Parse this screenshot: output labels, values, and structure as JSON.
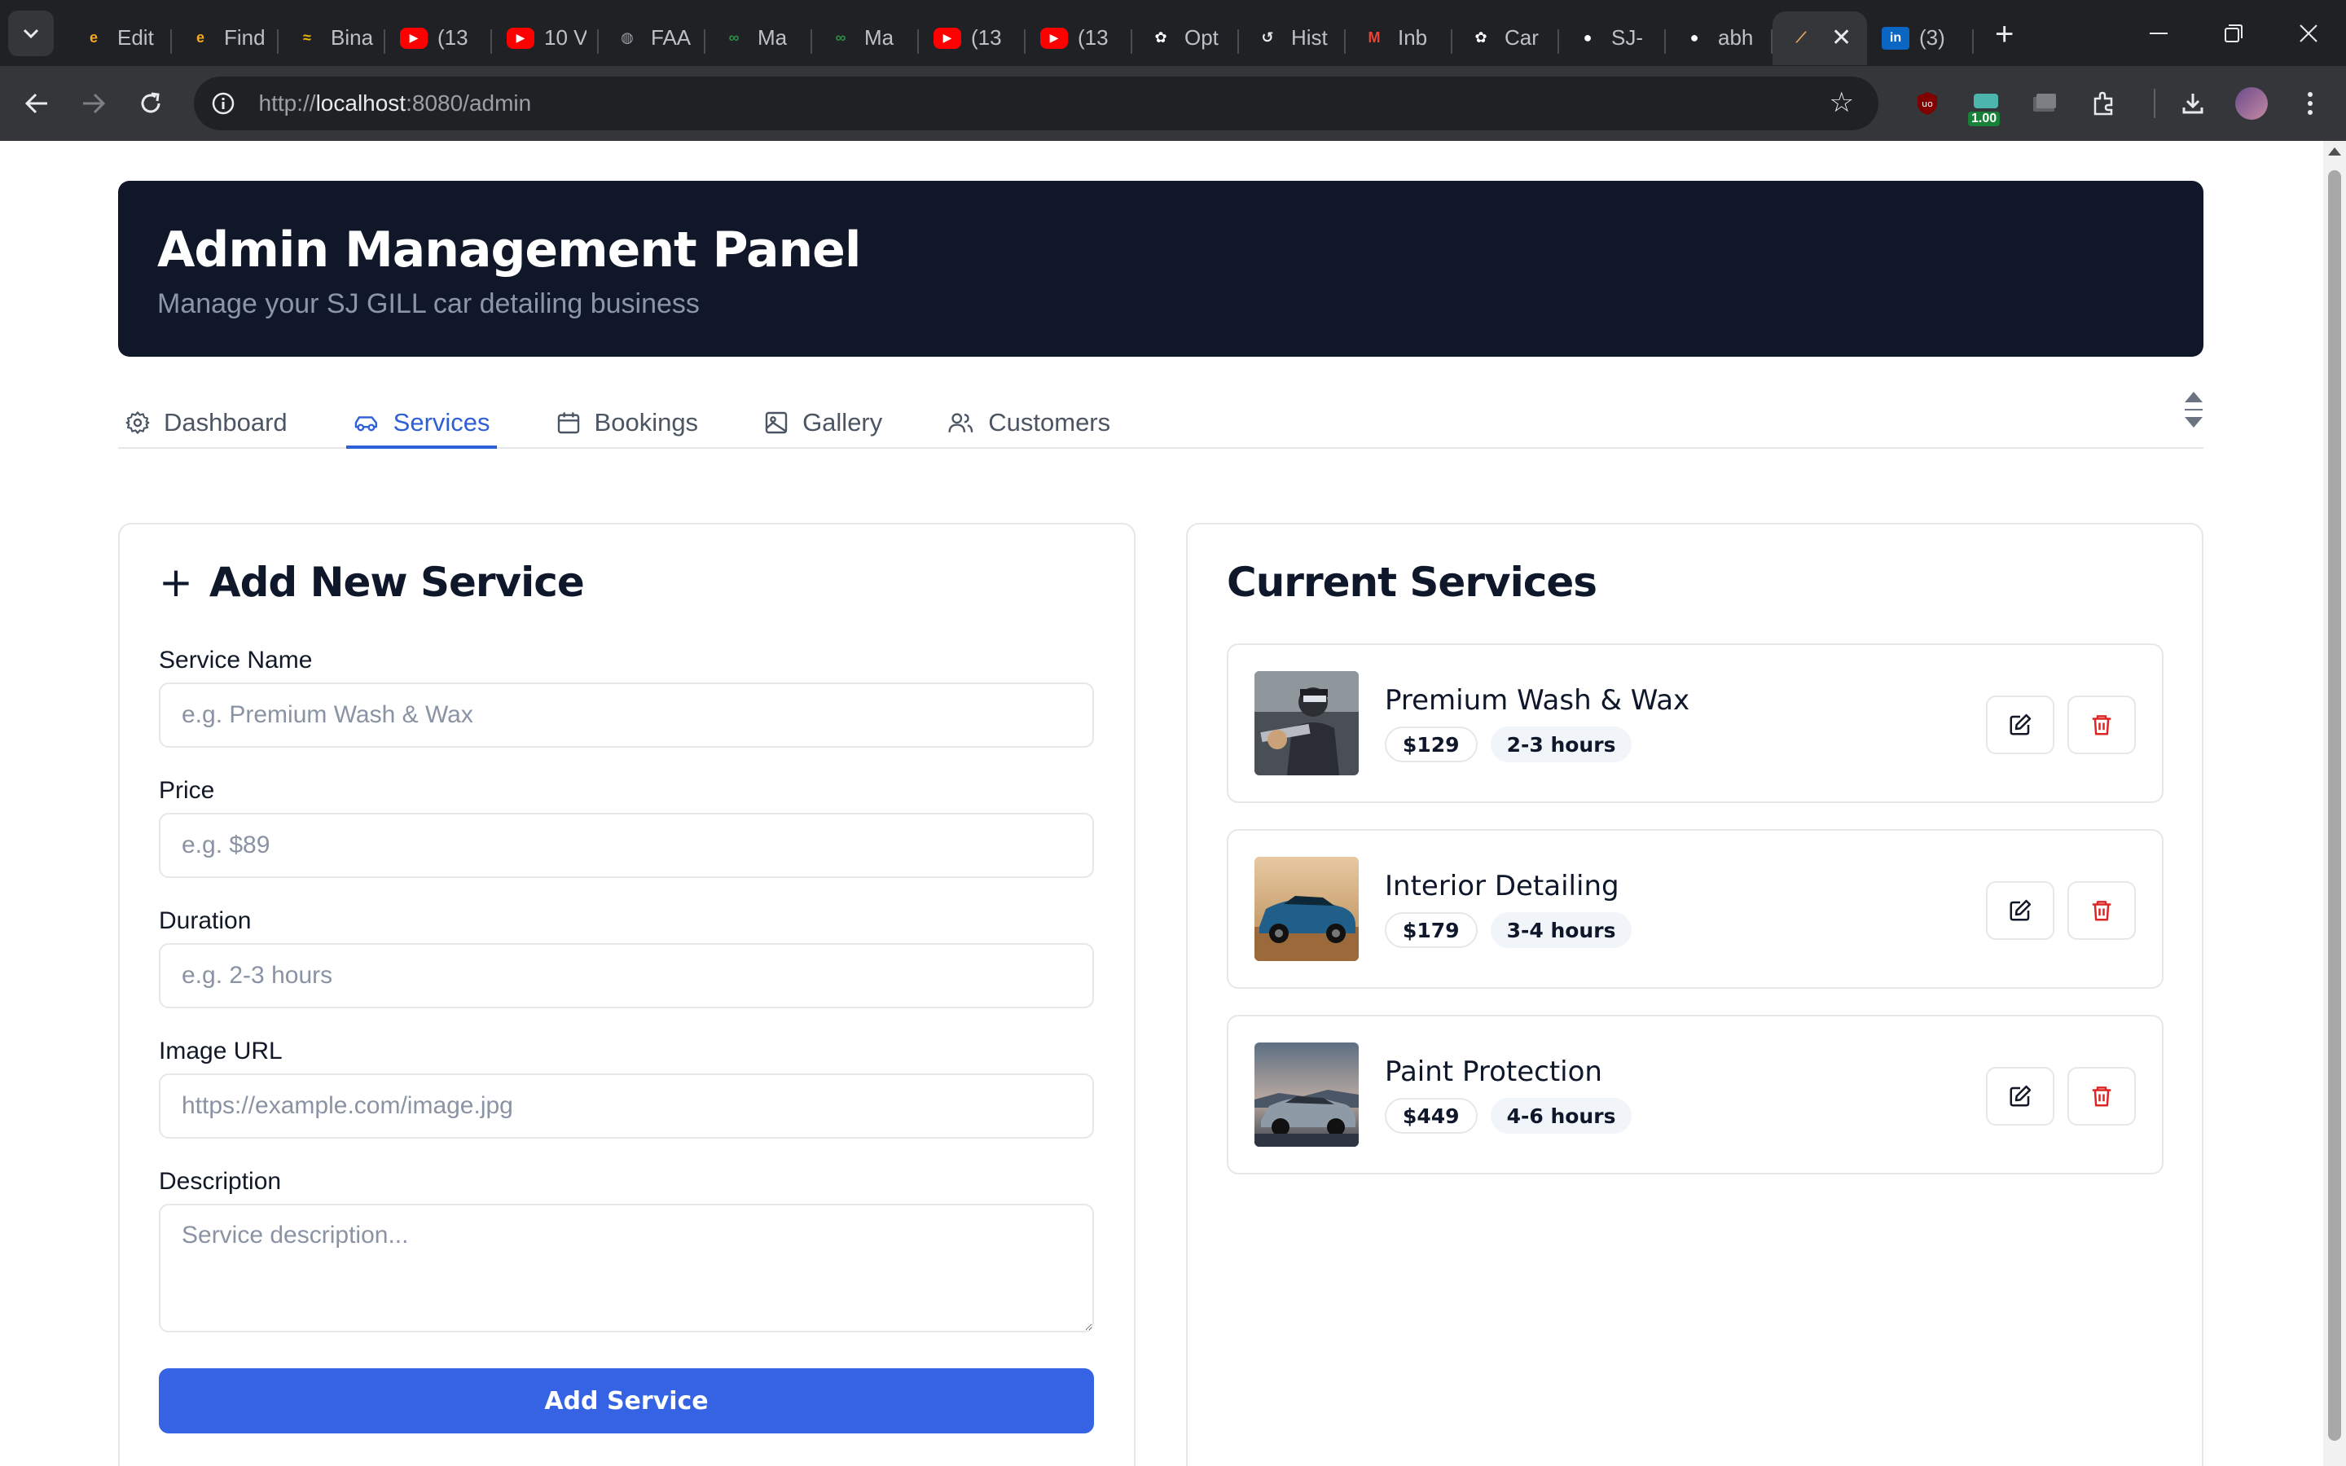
{
  "browser": {
    "tabs": [
      {
        "title": "Edit",
        "icon": "circle-logo-icon",
        "color": "#f6a821"
      },
      {
        "title": "Find",
        "icon": "circle-logo-icon",
        "color": "#f6a821"
      },
      {
        "title": "Bina",
        "icon": "binance-icon",
        "color": "#f0b90b"
      },
      {
        "title": "(13",
        "icon": "youtube-icon",
        "color": "#ff0000"
      },
      {
        "title": "10 V",
        "icon": "youtube-icon",
        "color": "#ff0000"
      },
      {
        "title": "FAA",
        "icon": "globe-icon",
        "color": "#9aa0a6"
      },
      {
        "title": "Ma",
        "icon": "geeks-icon",
        "color": "#2f8d46"
      },
      {
        "title": "Ma",
        "icon": "geeks-icon",
        "color": "#2f8d46"
      },
      {
        "title": "(13",
        "icon": "youtube-icon",
        "color": "#ff0000"
      },
      {
        "title": "(13",
        "icon": "youtube-icon",
        "color": "#ff0000"
      },
      {
        "title": "Opt",
        "icon": "openai-icon",
        "color": "#ffffff"
      },
      {
        "title": "Hist",
        "icon": "history-icon",
        "color": "#e8eaed"
      },
      {
        "title": "Inb",
        "icon": "gmail-icon",
        "color": "#ea4335"
      },
      {
        "title": "Car",
        "icon": "openai-icon",
        "color": "#ffffff"
      },
      {
        "title": "SJ-",
        "icon": "github-icon",
        "color": "#ffffff"
      },
      {
        "title": "abh",
        "icon": "github-icon",
        "color": "#ffffff"
      },
      {
        "title": "",
        "icon": "app-logo-icon",
        "color": "#e0a85c",
        "active": true
      },
      {
        "title": "(3)",
        "icon": "linkedin-icon",
        "color": "#0a66c2"
      }
    ],
    "url_prefix": "http://",
    "url_host": "localhost",
    "url_rest": ":8080/admin",
    "extension_badge": "1.00"
  },
  "hero": {
    "title": "Admin Management Panel",
    "subtitle": "Manage your SJ GILL car detailing business"
  },
  "nav": {
    "tabs": [
      {
        "label": "Dashboard",
        "icon": "gear-icon"
      },
      {
        "label": "Services",
        "icon": "car-icon",
        "active": true
      },
      {
        "label": "Bookings",
        "icon": "calendar-icon"
      },
      {
        "label": "Gallery",
        "icon": "image-icon"
      },
      {
        "label": "Customers",
        "icon": "users-icon"
      }
    ]
  },
  "form": {
    "title": "Add New Service",
    "fields": {
      "name": {
        "label": "Service Name",
        "placeholder": "e.g. Premium Wash & Wax",
        "value": ""
      },
      "price": {
        "label": "Price",
        "placeholder": "e.g. $89",
        "value": ""
      },
      "duration": {
        "label": "Duration",
        "placeholder": "e.g. 2-3 hours",
        "value": ""
      },
      "image": {
        "label": "Image URL",
        "placeholder": "https://example.com/image.jpg",
        "value": ""
      },
      "description": {
        "label": "Description",
        "placeholder": "Service description...",
        "value": ""
      }
    },
    "submit_label": "Add Service"
  },
  "services": {
    "title": "Current Services",
    "items": [
      {
        "name": "Premium Wash & Wax",
        "price": "$129",
        "duration": "2-3 hours"
      },
      {
        "name": "Interior Detailing",
        "price": "$179",
        "duration": "3-4 hours"
      },
      {
        "name": "Paint Protection",
        "price": "$449",
        "duration": "4-6 hours"
      }
    ]
  },
  "colors": {
    "hero_bg": "#101729",
    "accent": "#2f5fd6",
    "button": "#3563e3",
    "delete": "#dc2626"
  }
}
